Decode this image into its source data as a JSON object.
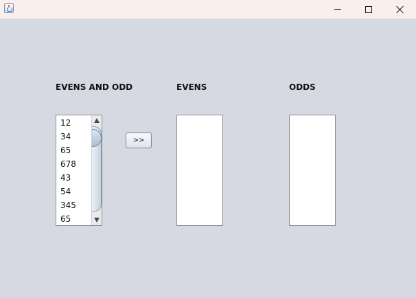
{
  "window": {
    "title": "",
    "icon": "java-cup-icon",
    "controls": [
      "minimize-icon",
      "maximize-icon",
      "close-icon"
    ],
    "colors": {
      "titlebar": "#f9efec",
      "content_background": "#d6d9e1",
      "list_background": "#ffffff",
      "list_border": "#8c8c8c"
    }
  },
  "labels": {
    "source": "EVENS AND ODD",
    "evens": "EVENS",
    "odds": "ODDS"
  },
  "source_list": {
    "items": [
      "12",
      "34",
      "65",
      "678",
      "43",
      "54",
      "345",
      "65"
    ]
  },
  "move_button": {
    "label": ">>"
  },
  "evens_list": {
    "items": []
  },
  "odds_list": {
    "items": []
  }
}
